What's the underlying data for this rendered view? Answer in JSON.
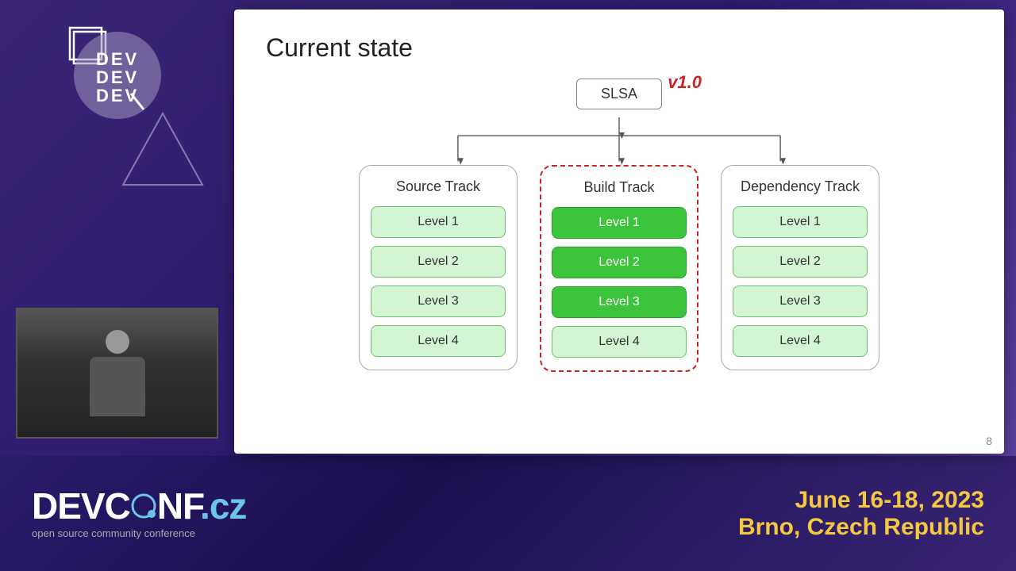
{
  "slide": {
    "title": "Current state",
    "number": "8",
    "slsa_label": "SLSA",
    "version_label": "v1.0",
    "tracks": [
      {
        "name": "source-track",
        "title": "Source Track",
        "levels": [
          {
            "label": "Level 1",
            "active": false
          },
          {
            "label": "Level 2",
            "active": false
          },
          {
            "label": "Level 3",
            "active": false
          },
          {
            "label": "Level 4",
            "active": false
          }
        ],
        "highlighted": false
      },
      {
        "name": "build-track",
        "title": "Build Track",
        "levels": [
          {
            "label": "Level 1",
            "active": true
          },
          {
            "label": "Level 2",
            "active": true
          },
          {
            "label": "Level 3",
            "active": true
          },
          {
            "label": "Level 4",
            "active": false
          }
        ],
        "highlighted": true
      },
      {
        "name": "dependency-track",
        "title": "Dependency Track",
        "levels": [
          {
            "label": "Level 1",
            "active": false
          },
          {
            "label": "Level 2",
            "active": false
          },
          {
            "label": "Level 3",
            "active": false
          },
          {
            "label": "Level 4",
            "active": false
          }
        ],
        "highlighted": false
      }
    ]
  },
  "branding": {
    "devconf_name": "DEVCONF",
    "devconf_tld": ".cz",
    "devconf_subtitle": "open source community conference",
    "event_date": "June 16-18, 2023",
    "event_location": "Brno, Czech Republic"
  }
}
